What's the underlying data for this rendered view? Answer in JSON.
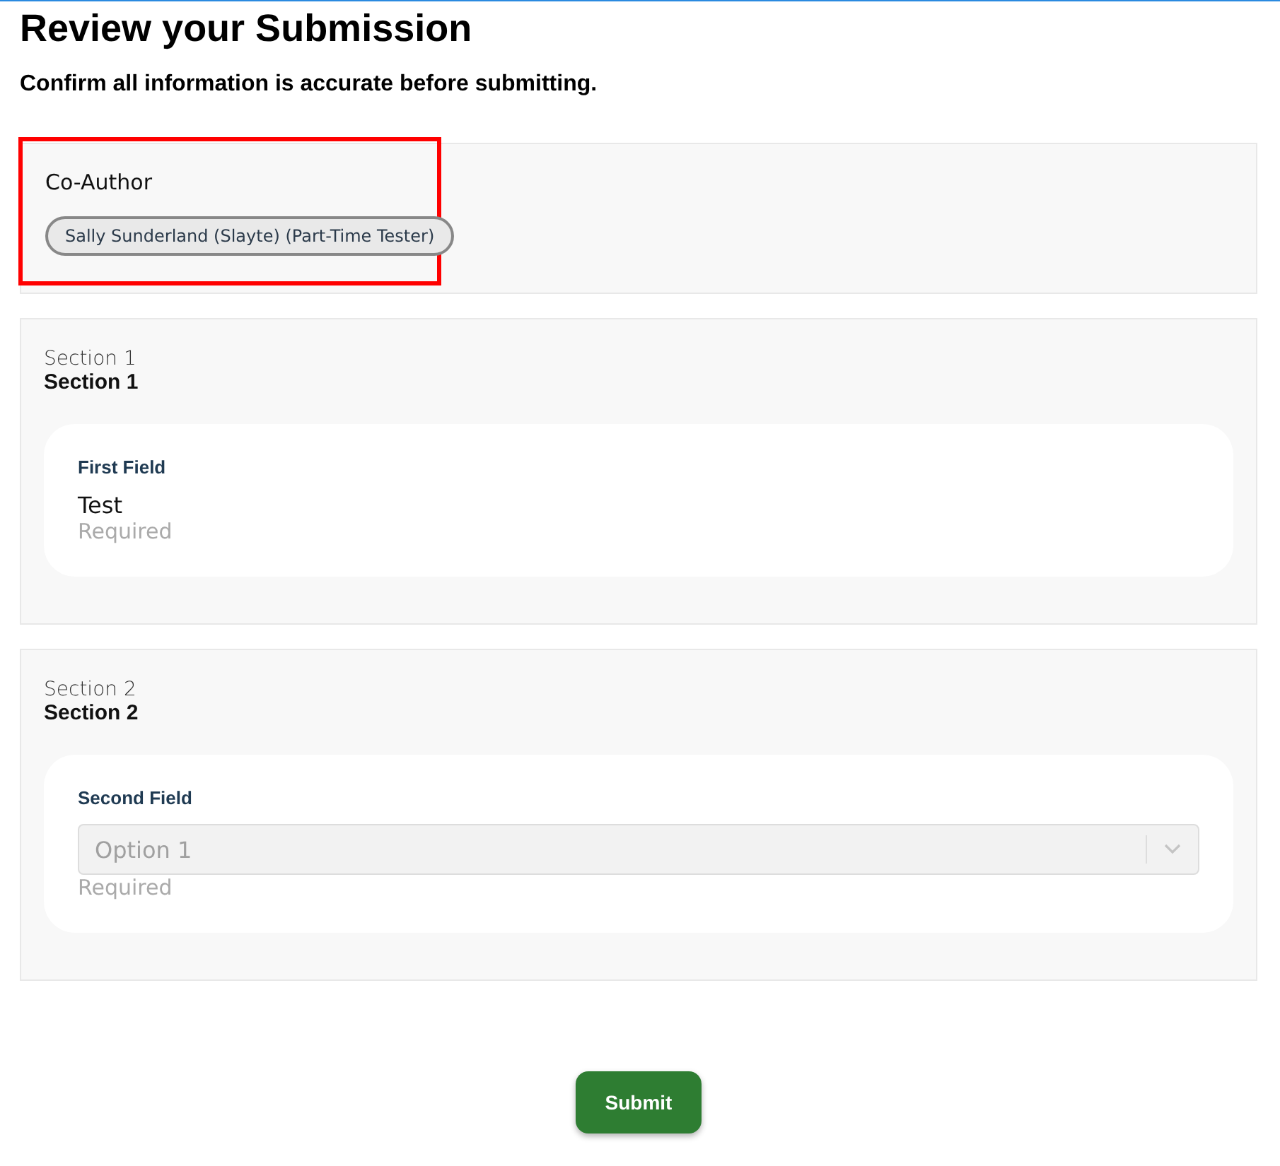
{
  "title": "Review your Submission",
  "subtitle": "Confirm all information is accurate before submitting.",
  "co_author": {
    "label": "Co-Author",
    "highlighted": true,
    "chips": [
      "Sally Sunderland (Slayte) (Part-Time Tester)"
    ]
  },
  "sections": [
    {
      "caption": "Section 1",
      "heading": "Section 1",
      "fields": [
        {
          "kind": "text",
          "label": "First Field",
          "value": "Test",
          "hint": "Required"
        }
      ]
    },
    {
      "caption": "Section 2",
      "heading": "Section 2",
      "fields": [
        {
          "kind": "select",
          "label": "Second Field",
          "value": "Option 1",
          "disabled": true,
          "hint": "Required"
        }
      ]
    }
  ],
  "submit_button": "Submit"
}
